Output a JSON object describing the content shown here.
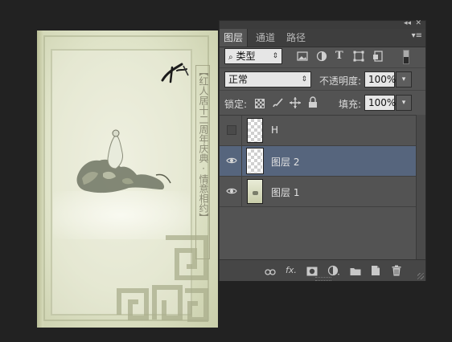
{
  "canvas": {
    "vertical_text": "【红人居十二周年庆典·情意相约】",
    "calligraphy": "和"
  },
  "panel": {
    "collapse_label": "◂◂",
    "close_label": "✕",
    "tabs": [
      {
        "label": "图层",
        "active": true
      },
      {
        "label": "通道",
        "active": false
      },
      {
        "label": "路径",
        "active": false
      }
    ],
    "menu_label": "▾≡",
    "filter": {
      "kind_label": "类型",
      "icons": [
        "image-filter-icon",
        "adjustment-filter-icon",
        "type-filter-icon",
        "shape-filter-icon",
        "smart-object-filter-icon",
        "filter-toggle-icon"
      ]
    },
    "blend_mode": "正常",
    "opacity": {
      "label": "不透明度:",
      "value": "100%"
    },
    "lock": {
      "label": "锁定:",
      "icons": [
        "lock-transparent-icon",
        "lock-paint-icon",
        "lock-position-icon",
        "lock-all-icon"
      ]
    },
    "fill": {
      "label": "填充:",
      "value": "100%"
    },
    "layers": [
      {
        "name": "H",
        "visible": false,
        "selected": false,
        "thumb": "checker"
      },
      {
        "name": "图层 2",
        "visible": true,
        "selected": true,
        "thumb": "checker"
      },
      {
        "name": "图层 1",
        "visible": true,
        "selected": false,
        "thumb": "image"
      }
    ],
    "footer": {
      "link_label": "⊖",
      "fx_label": "fx.",
      "icons": [
        "link-layers-icon",
        "fx-icon",
        "mask-icon",
        "adjustment-layer-icon",
        "group-folder-icon",
        "new-layer-icon",
        "trash-icon"
      ]
    }
  },
  "colors": {
    "panel_bg": "#535353",
    "selected_row": "#56657d",
    "app_bg": "#222222"
  }
}
